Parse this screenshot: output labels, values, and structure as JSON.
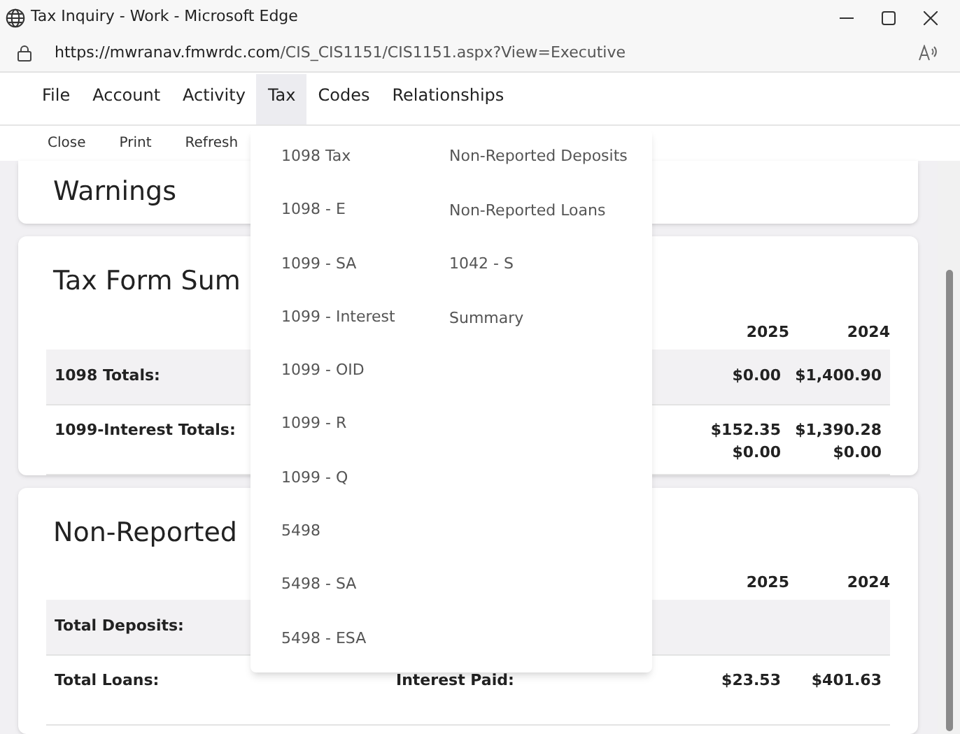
{
  "window": {
    "title": "Tax Inquiry - Work - Microsoft Edge",
    "url_host": "https://mwranav.fmwrdc.com",
    "url_path": "/CIS_CIS1151/CIS1151.aspx?View=Executive"
  },
  "menu": [
    {
      "label": "File",
      "selected": false
    },
    {
      "label": "Account",
      "selected": false
    },
    {
      "label": "Activity",
      "selected": false
    },
    {
      "label": "Tax",
      "selected": true
    },
    {
      "label": "Codes",
      "selected": false
    },
    {
      "label": "Relationships",
      "selected": false
    }
  ],
  "toolbar": [
    "Close",
    "Print",
    "Refresh"
  ],
  "tax_menu": {
    "column_1": [
      "1098 Tax",
      "1098 - E",
      "1099 - SA",
      "1099 - Interest",
      "1099 - OID",
      "1099 - R",
      "1099 - Q",
      "5498",
      "5498 - SA",
      "5498 - ESA"
    ],
    "column_2": [
      "Non-Reported Deposits",
      "Non-Reported Loans",
      "1042 - S",
      "Summary"
    ]
  },
  "warnings": {
    "title": "Warnings"
  },
  "tax_form_summary": {
    "title": "Tax Form Sum",
    "years": [
      "2025",
      "2024"
    ],
    "rows": [
      {
        "label": "1098 Totals:",
        "shaded": true,
        "lines": [
          {
            "values": [
              "$0.00",
              "$1,400.90"
            ]
          }
        ]
      },
      {
        "label": "1099-Interest Totals:",
        "shaded": false,
        "lines": [
          {
            "values": [
              "$152.35",
              "$1,390.28"
            ]
          },
          {
            "values": [
              "$0.00",
              "$0.00"
            ]
          }
        ]
      }
    ]
  },
  "non_reported_summary": {
    "title": "Non-Reported",
    "years": [
      "2025",
      "2024"
    ],
    "rows": [
      {
        "label": "Total Deposits:",
        "shaded": true,
        "lines": []
      },
      {
        "label": "Total Loans:",
        "shaded": false,
        "lines": [
          {
            "name": "Interest Paid:",
            "values": [
              "$23.53",
              "$401.63"
            ]
          }
        ]
      }
    ]
  }
}
